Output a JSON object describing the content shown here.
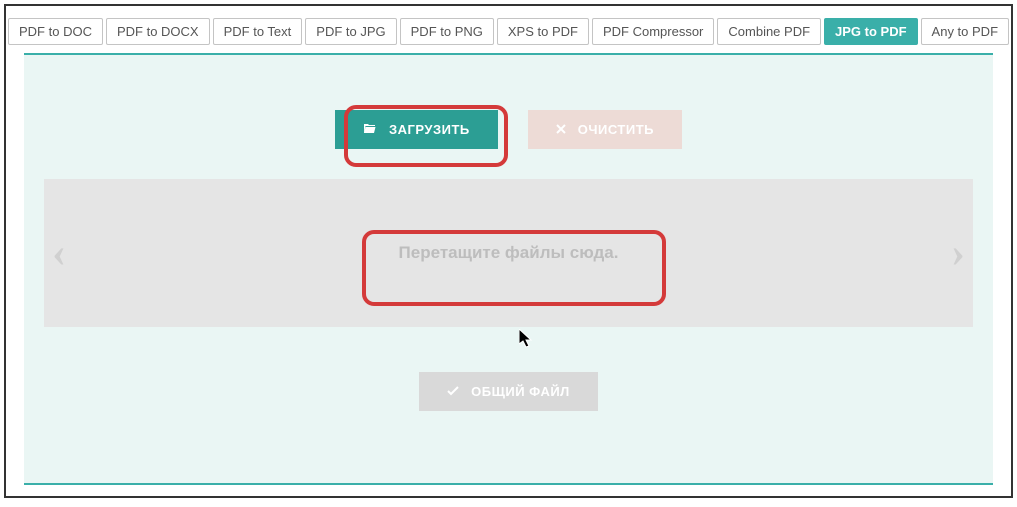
{
  "tabs": [
    {
      "label": "PDF to DOC",
      "active": false
    },
    {
      "label": "PDF to DOCX",
      "active": false
    },
    {
      "label": "PDF to Text",
      "active": false
    },
    {
      "label": "PDF to JPG",
      "active": false
    },
    {
      "label": "PDF to PNG",
      "active": false
    },
    {
      "label": "XPS to PDF",
      "active": false
    },
    {
      "label": "PDF Compressor",
      "active": false
    },
    {
      "label": "Combine PDF",
      "active": false
    },
    {
      "label": "JPG to PDF",
      "active": true
    },
    {
      "label": "Any to PDF",
      "active": false
    }
  ],
  "buttons": {
    "upload": "ЗАГРУЗИТЬ",
    "clear": "ОЧИСТИТЬ",
    "combined": "ОБЩИЙ ФАЙЛ"
  },
  "dropzone": {
    "text": "Перетащите файлы сюда."
  },
  "icons": {
    "folder": "folder-open-icon",
    "close": "close-icon",
    "check": "check-icon"
  }
}
